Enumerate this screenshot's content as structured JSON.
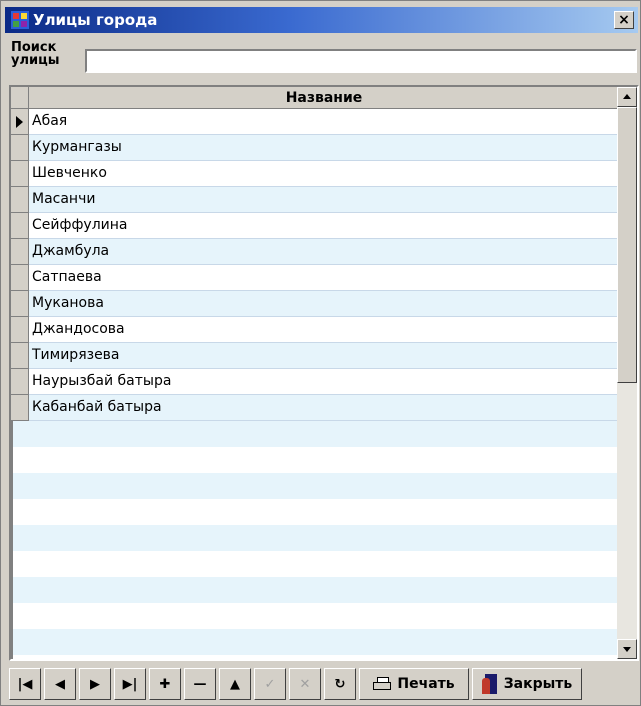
{
  "window": {
    "title": "Улицы города",
    "close_glyph": "×"
  },
  "search": {
    "label_line1": "Поиск",
    "label_line2": "улицы",
    "value": "",
    "placeholder": ""
  },
  "grid": {
    "column_header": "Название",
    "selected_row_index": 0,
    "rows": [
      "Абая",
      "Курмангазы",
      "Шевченко",
      "Масанчи",
      "Сейффулина",
      "Джамбула",
      "Сатпаева",
      "Муканова",
      "Джандосова",
      "Тимирязева",
      "Наурызбай батыра",
      "Кабанбай батыра"
    ]
  },
  "navigator": {
    "first_glyph": "|◀",
    "prior_glyph": "◀",
    "next_glyph": "▶",
    "last_glyph": "▶|",
    "insert_glyph": "✚",
    "delete_glyph": "—",
    "edit_glyph": "▲",
    "post_glyph": "✓",
    "cancel_glyph": "✕",
    "refresh_glyph": "↻",
    "print_label": "Печать",
    "close_label": "Закрыть"
  },
  "icons": {
    "app": "app-icon",
    "printer": "printer-icon",
    "exit": "door-exit-icon"
  },
  "colors": {
    "title_start": "#0b2a86",
    "title_end": "#a6caf0",
    "row_alt": "#e6f4fb",
    "face": "#d4d0c8"
  }
}
